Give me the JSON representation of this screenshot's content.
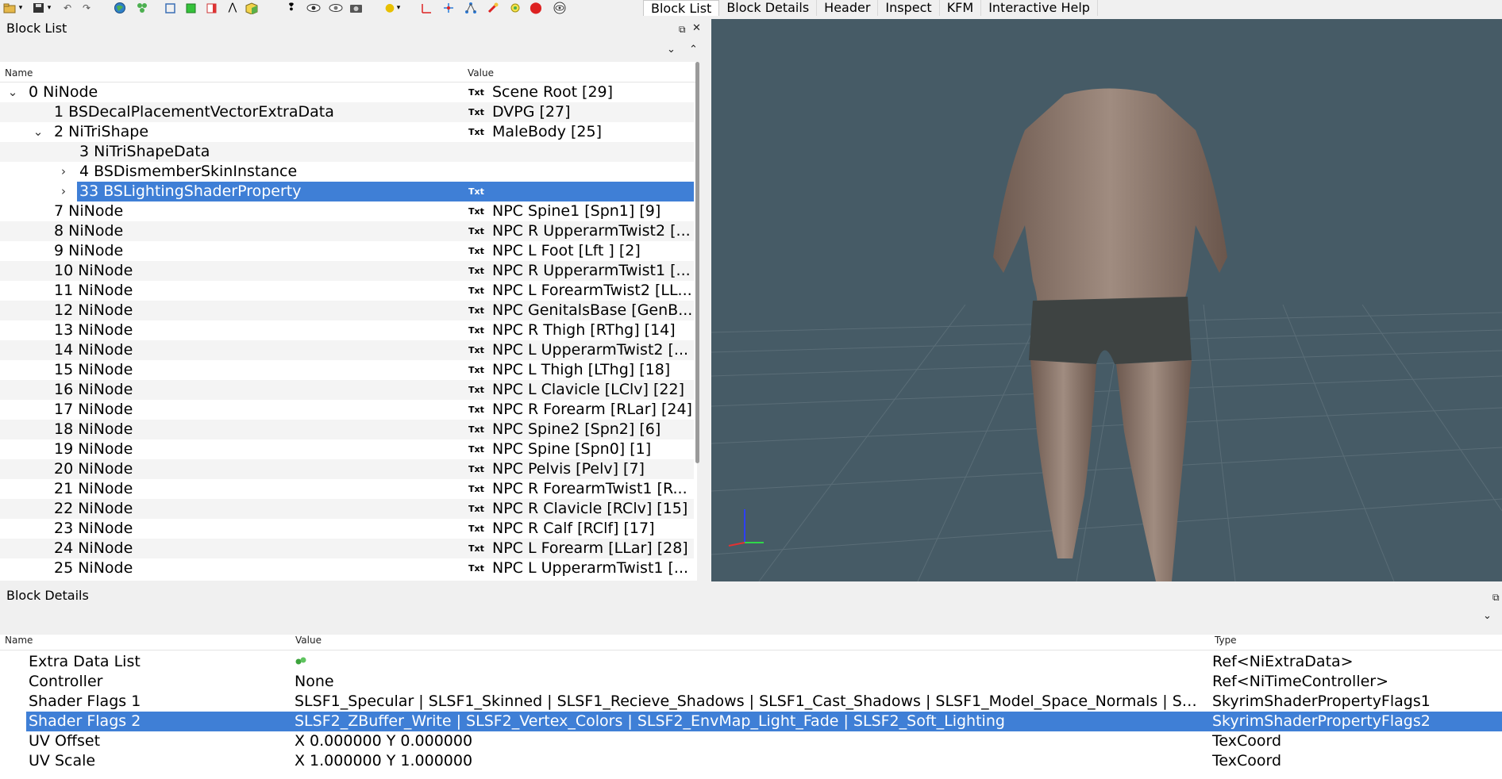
{
  "tabs": [
    "Block List",
    "Block Details",
    "Header",
    "Inspect",
    "KFM",
    "Interactive Help"
  ],
  "block_list": {
    "title": "Block List",
    "col_name": "Name",
    "col_value": "Value",
    "txt_badge": "Txt",
    "rows": [
      {
        "name": "0 NiNode",
        "value": "Scene Root [29]"
      },
      {
        "name": "1 BSDecalPlacementVectorExtraData",
        "value": "DVPG [27]"
      },
      {
        "name": "2 NiTriShape",
        "value": "MaleBody [25]"
      },
      {
        "name": "3 NiTriShapeData",
        "value": ""
      },
      {
        "name": "4 BSDismemberSkinInstance",
        "value": ""
      },
      {
        "name": "33 BSLightingShaderProperty",
        "value": ""
      },
      {
        "name": "7 NiNode",
        "value": "NPC Spine1 [Spn1] [9]"
      },
      {
        "name": "8 NiNode",
        "value": "NPC R UpperarmTwist2 [..."
      },
      {
        "name": "9 NiNode",
        "value": "NPC L Foot [Lft ] [2]"
      },
      {
        "name": "10 NiNode",
        "value": "NPC R UpperarmTwist1 [..."
      },
      {
        "name": "11 NiNode",
        "value": "NPC L ForearmTwist2 [LL..."
      },
      {
        "name": "12 NiNode",
        "value": "NPC GenitalsBase [GenB..."
      },
      {
        "name": "13 NiNode",
        "value": "NPC R Thigh [RThg] [14]"
      },
      {
        "name": "14 NiNode",
        "value": "NPC L UpperarmTwist2 [..."
      },
      {
        "name": "15 NiNode",
        "value": "NPC L Thigh [LThg] [18]"
      },
      {
        "name": "16 NiNode",
        "value": "NPC L Clavicle [LClv] [22]"
      },
      {
        "name": "17 NiNode",
        "value": "NPC R Forearm [RLar] [24]"
      },
      {
        "name": "18 NiNode",
        "value": "NPC Spine2 [Spn2] [6]"
      },
      {
        "name": "19 NiNode",
        "value": "NPC Spine [Spn0] [1]"
      },
      {
        "name": "20 NiNode",
        "value": "NPC Pelvis [Pelv] [7]"
      },
      {
        "name": "21 NiNode",
        "value": "NPC R ForearmTwist1 [R..."
      },
      {
        "name": "22 NiNode",
        "value": "NPC R Clavicle [RClv] [15]"
      },
      {
        "name": "23 NiNode",
        "value": "NPC R Calf [RClf] [17]"
      },
      {
        "name": "24 NiNode",
        "value": "NPC L Forearm [LLar] [28]"
      },
      {
        "name": "25 NiNode",
        "value": "NPC L UpperarmTwist1 [..."
      }
    ]
  },
  "block_details": {
    "title": "Block Details",
    "col_name": "Name",
    "col_value": "Value",
    "col_type": "Type",
    "rows": [
      {
        "name": "Extra Data List",
        "value": "",
        "type": "Ref<NiExtraData>"
      },
      {
        "name": "Controller",
        "value": "None",
        "type": "Ref<NiTimeController>"
      },
      {
        "name": "Shader Flags 1",
        "value": "SLSF1_Specular | SLSF1_Skinned | SLSF1_Recieve_Shadows | SLSF1_Cast_Shadows | SLSF1_Model_Space_Normals | SLSF1_Fa...",
        "type": "SkyrimShaderPropertyFlags1"
      },
      {
        "name": "Shader Flags 2",
        "value": "SLSF2_ZBuffer_Write | SLSF2_Vertex_Colors | SLSF2_EnvMap_Light_Fade | SLSF2_Soft_Lighting",
        "type": "SkyrimShaderPropertyFlags2"
      },
      {
        "name": "UV Offset",
        "value": "X 0.000000 Y 0.000000",
        "type": "TexCoord"
      },
      {
        "name": "UV Scale",
        "value": "X 1.000000 Y 1.000000",
        "type": "TexCoord"
      }
    ]
  },
  "colors": {
    "selection": "#3f7fd6",
    "viewport_bg": "#465b66"
  }
}
